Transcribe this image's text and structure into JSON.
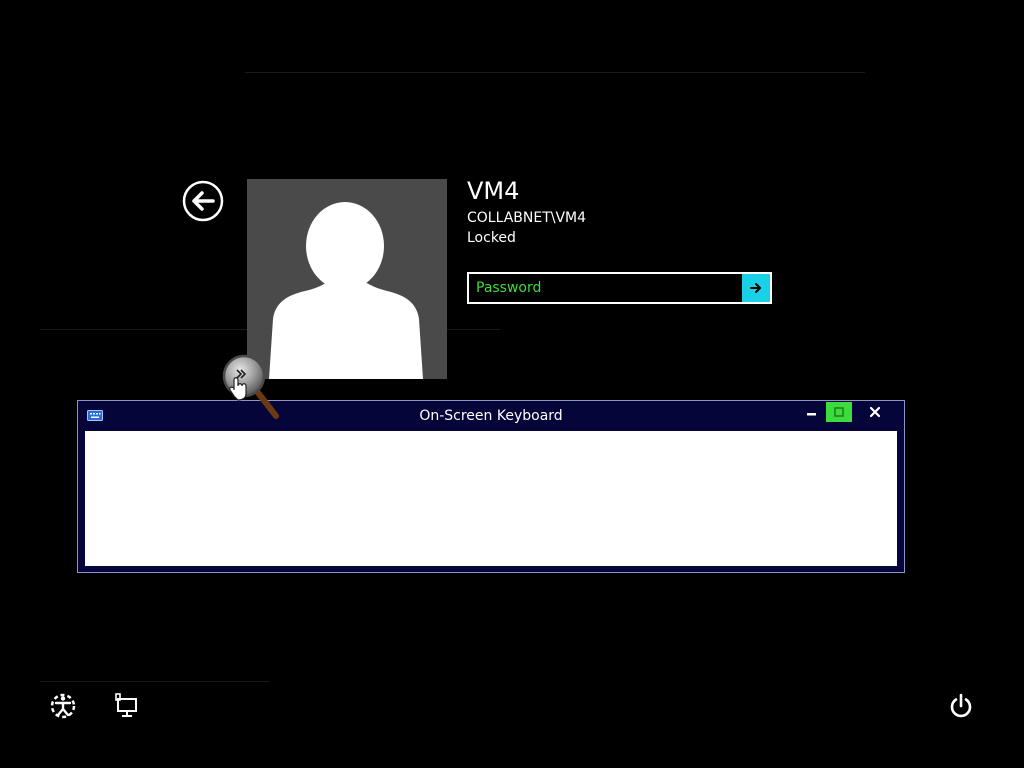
{
  "user": {
    "name": "VM4",
    "account": "COLLABNET\\VM4",
    "status": "Locked",
    "avatar_icon": "user-silhouette-icon",
    "tile_color": "#4a4a4a"
  },
  "password": {
    "placeholder": "Password",
    "value": "",
    "submit_icon": "arrow-right-icon",
    "submit_color": "#19d1e6",
    "placeholder_color": "#3ddc3d"
  },
  "navigation": {
    "back_icon": "back-arrow-icon"
  },
  "osk": {
    "title": "On-Screen Keyboard",
    "app_icon": "keyboard-icon",
    "minimize_icon": "minimize-icon",
    "maximize_icon": "maximize-icon",
    "close_icon": "close-icon",
    "titlebar_color": "#05053a",
    "maximize_highlight_color": "#3ddc3d"
  },
  "magnifier": {
    "icon": "magnifier-icon"
  },
  "bottom_bar": {
    "ease_of_access_icon": "ease-of-access-icon",
    "network_icon": "network-icon",
    "power_icon": "power-icon"
  }
}
